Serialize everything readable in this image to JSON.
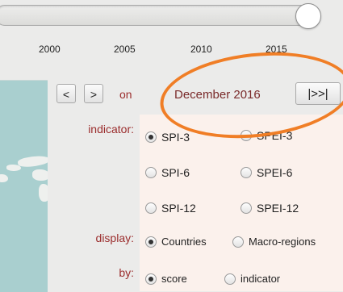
{
  "timeline": {
    "tick_labels": [
      "2000",
      "2005",
      "2010",
      "2015"
    ],
    "position": 1.0
  },
  "navigation": {
    "prev_label": "<",
    "next_label": ">",
    "on_label": "on",
    "date": "December 2016",
    "latest_label": "|>>|"
  },
  "options": {
    "indicator": {
      "label": "indicator:",
      "choices": [
        "SPI-3",
        "SPEI-3",
        "SPI-6",
        "SPEI-6",
        "SPI-12",
        "SPEI-12"
      ],
      "selected": "SPI-3"
    },
    "display": {
      "label": "display:",
      "choices": [
        "Countries",
        "Macro-regions"
      ],
      "selected": "Countries"
    },
    "by": {
      "label": "by:",
      "choices": [
        "score",
        "indicator"
      ],
      "selected": "score"
    }
  },
  "colors": {
    "label_red": "#9b2d2d",
    "date_red": "#7a2a2a",
    "highlight_orange": "#f07e26",
    "panel_bg": "#fbf1ec",
    "map_water": "#a9cfcf"
  }
}
